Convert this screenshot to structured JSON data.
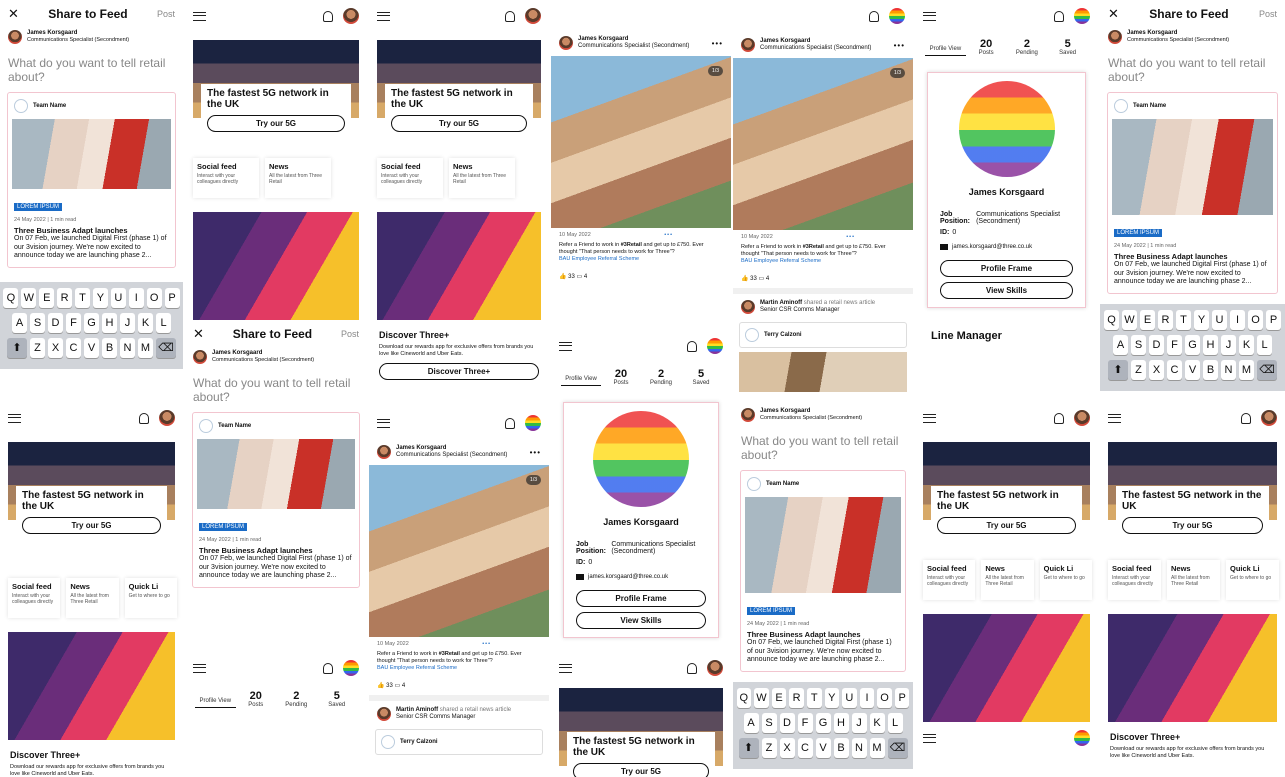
{
  "share": {
    "title": "Share to Feed",
    "post": "Post",
    "prompt": "What do you want to tell retail about?"
  },
  "user": {
    "name": "James Korsgaard",
    "role": "Communications Specialist (Secondment)",
    "email": "james.korsgaard@three.co.uk",
    "position_label": "Job Position:",
    "position": "Communications Specialist (Secondment)",
    "id_label": "ID:",
    "id": "0"
  },
  "article": {
    "team": "Team Name",
    "tag": "LOREM IPSUM",
    "meta": "24 May 2022  |  1 min read",
    "title": "Three Business Adapt launches",
    "body": "On 07 Feb, we launched Digital First (phase 1) of our 3vision journey. We're now excited to announce today we are launching phase 2..."
  },
  "keyboard": {
    "row1": [
      "Q",
      "W",
      "E",
      "R",
      "T",
      "Y",
      "U",
      "I",
      "O",
      "P"
    ],
    "row2": [
      "A",
      "S",
      "D",
      "F",
      "G",
      "H",
      "J",
      "K",
      "L"
    ],
    "row3": [
      "Z",
      "X",
      "C",
      "V",
      "B",
      "N",
      "M"
    ]
  },
  "home": {
    "banner_title": "The fastest 5G network in the UK",
    "banner_button": "Try our 5G",
    "tiles": [
      {
        "title": "Social feed",
        "desc": "Interact with your colleagues directly"
      },
      {
        "title": "News",
        "desc": "All the latest from Three Retail"
      },
      {
        "title": "Quick Li",
        "desc": "Get to where to go"
      }
    ],
    "discover_title": "Discover Three+",
    "discover_desc": "Download our rewards app for exclusive offers from brands you love like Cineworld and Uber Eats.",
    "discover_button": "Discover Three+"
  },
  "post": {
    "badge": "1/3",
    "date": "10 May 2022",
    "text_pre": "Refer a Friend to work in ",
    "hashtag": "#3Retail",
    "text_post": " and get up to £750. Ever thought \"That person needs to work for Three\"?",
    "link": "BAU Employee Referral Scheme",
    "likes": "33",
    "comments": "4"
  },
  "share_post": {
    "name": "Martin Aminoff",
    "action": "shared a retail news article",
    "role": "Senior CSR Comms Manager",
    "terry": "Terry Calzoni"
  },
  "profile": {
    "tabs": [
      {
        "v": "",
        "l": "Profile View"
      },
      {
        "v": "20",
        "l": "Posts"
      },
      {
        "v": "2",
        "l": "Pending"
      },
      {
        "v": "5",
        "l": "Saved"
      }
    ],
    "frame_button": "Profile Frame",
    "skills_button": "View Skills",
    "line_manager": "Line Manager"
  }
}
